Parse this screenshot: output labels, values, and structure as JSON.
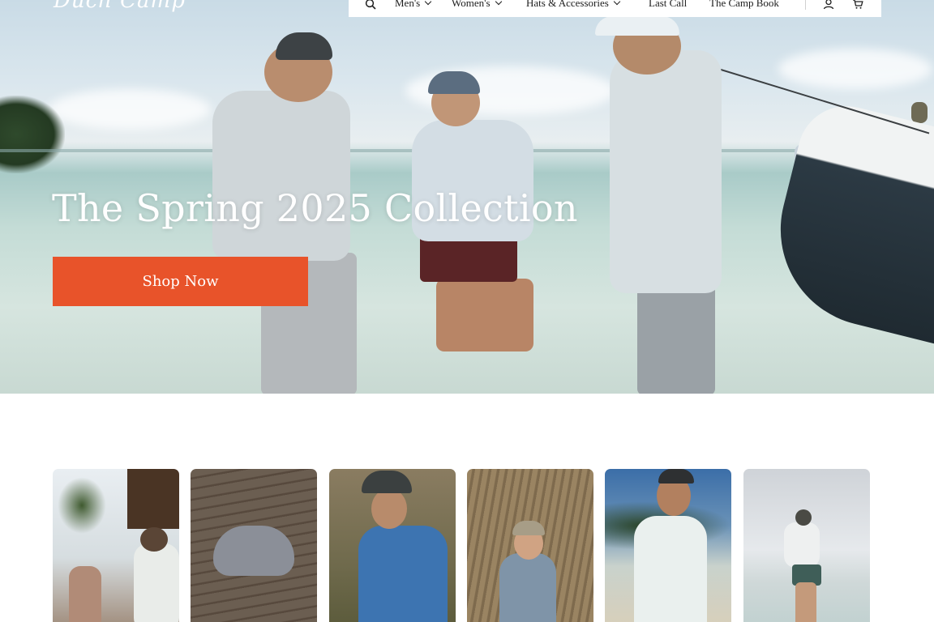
{
  "brand": {
    "logo_text": "Duch Camp"
  },
  "nav": {
    "items": [
      {
        "label": "Men's",
        "has_dropdown": true
      },
      {
        "label": "Women's",
        "has_dropdown": true
      },
      {
        "label": "Hats & Accessories",
        "has_dropdown": true
      },
      {
        "label": "Last Call",
        "has_dropdown": false
      },
      {
        "label": "The Camp Book",
        "has_dropdown": false
      }
    ],
    "icons": [
      "search-icon",
      "account-icon",
      "cart-icon"
    ]
  },
  "hero": {
    "title": "The Spring 2025 Collection",
    "cta_label": "Shop Now",
    "cta_color": "#e8532a"
  },
  "cards": [
    {
      "subject": "woman and man on deck with palms"
    },
    {
      "subject": "cap on wooden dock"
    },
    {
      "subject": "man in blue jacket"
    },
    {
      "subject": "woman in straw"
    },
    {
      "subject": "man in white shirt on beach"
    },
    {
      "subject": "angler casting on flats"
    }
  ],
  "colors": {
    "accent": "#e8532a",
    "text": "#1d1d1d",
    "background": "#ffffff"
  }
}
